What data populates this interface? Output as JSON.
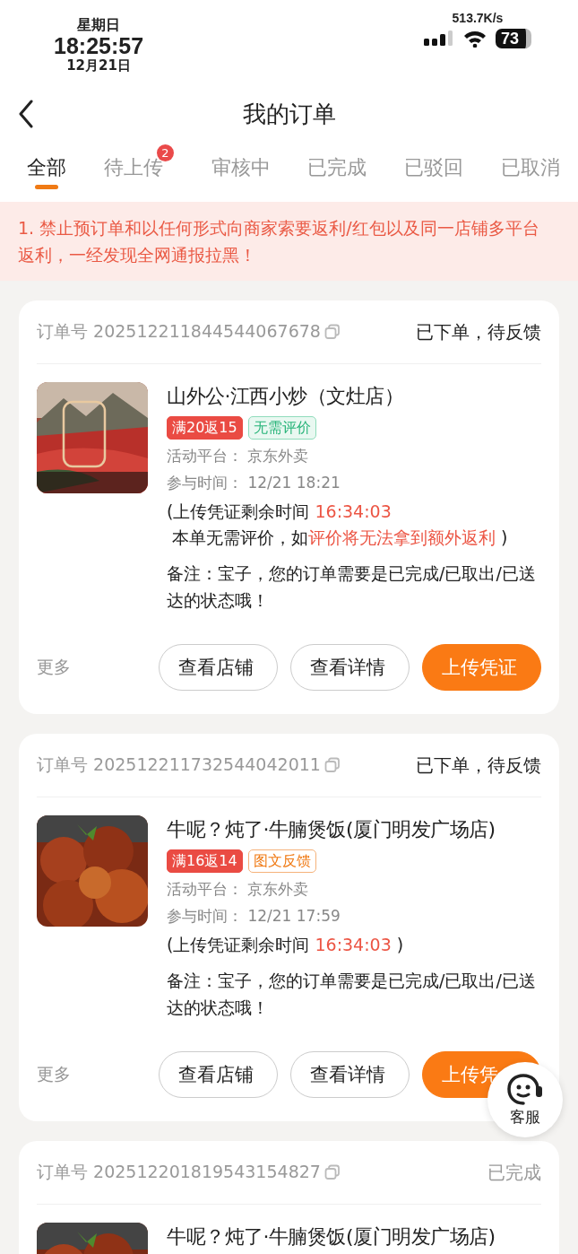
{
  "status_bar": {
    "weekday": "星期日",
    "time": "18:25:57",
    "date": "12月21日",
    "net_speed": "513.7K/s",
    "battery": "73"
  },
  "nav": {
    "title": "我的订单"
  },
  "tabs": [
    {
      "label": "全部",
      "selected": true
    },
    {
      "label": "待上传",
      "selected": false,
      "badge": "2"
    },
    {
      "label": "审核中",
      "selected": false
    },
    {
      "label": "已完成",
      "selected": false
    },
    {
      "label": "已驳回",
      "selected": false
    },
    {
      "label": "已取消",
      "selected": false
    }
  ],
  "notice": "1. 禁止预订单和以任何形式向商家索要返利/红包以及同一店铺多平台返利，一经发现全网通报拉黑！",
  "orders": [
    {
      "order_label": "订单号",
      "order_no": "202512211844544067678",
      "status": "已下单，待反馈",
      "completed": false,
      "store": "山外公·江西小炒（文灶店）",
      "tags": [
        {
          "text": "满20返15",
          "kind": "rebate"
        },
        {
          "text": "无需评价",
          "kind": "no_review"
        }
      ],
      "platform_label": "活动平台：",
      "platform": "京东外卖",
      "time_label": "参与时间：",
      "time": "12/21 18:21",
      "countdown": {
        "prefix": "(上传凭证剩余时间",
        "time": "16:34:03",
        "note": "本单无需评价，如",
        "warning": "评价将无法拿到额外返利",
        "suffix": ")"
      },
      "remark": "备注：宝子，您的订单需要是已完成/已取出/已送达的状态哦！",
      "more": "更多",
      "actions": [
        {
          "label": "查看店铺",
          "kind": "outline"
        },
        {
          "label": "查看详情",
          "kind": "outline"
        },
        {
          "label": "上传凭证",
          "kind": "primary"
        }
      ]
    },
    {
      "order_label": "订单号",
      "order_no": "202512211732544042011",
      "status": "已下单，待反馈",
      "completed": false,
      "store": "牛呢？炖了·牛腩煲饭(厦门明发广场店)",
      "tags": [
        {
          "text": "满16返14",
          "kind": "rebate"
        },
        {
          "text": "图文反馈",
          "kind": "photo_feedback"
        }
      ],
      "platform_label": "活动平台：",
      "platform": "京东外卖",
      "time_label": "参与时间：",
      "time": "12/21 17:59",
      "countdown": {
        "prefix": "(上传凭证剩余时间",
        "time": "16:34:03",
        "suffix": ")"
      },
      "remark": "备注：宝子，您的订单需要是已完成/已取出/已送达的状态哦！",
      "more": "更多",
      "actions": [
        {
          "label": "查看店铺",
          "kind": "outline"
        },
        {
          "label": "查看详情",
          "kind": "outline"
        },
        {
          "label": "上传凭",
          "kind": "primary"
        }
      ]
    },
    {
      "order_label": "订单号",
      "order_no": "202512201819543154827",
      "status": "已完成",
      "completed": true,
      "store": "牛呢？炖了·牛腩煲饭(厦门明发广场店)"
    }
  ],
  "support_button": {
    "label": "客服"
  }
}
